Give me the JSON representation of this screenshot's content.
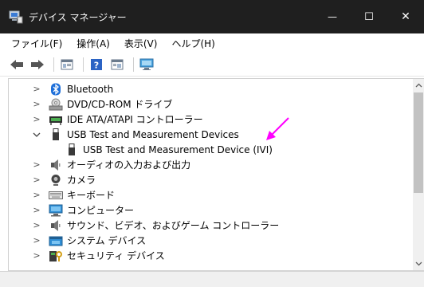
{
  "window": {
    "title": "デバイス マネージャー",
    "buttons": {
      "minimize": "—",
      "maximize": "☐",
      "close": "✕"
    }
  },
  "menu": [
    {
      "label": "ファイル(F)"
    },
    {
      "label": "操作(A)"
    },
    {
      "label": "表示(V)"
    },
    {
      "label": "ヘルプ(H)"
    }
  ],
  "toolbar": {
    "icons": [
      "back-icon",
      "forward-icon",
      "properties-icon",
      "help-icon",
      "details-icon",
      "monitor-icon"
    ]
  },
  "tree": {
    "items": [
      {
        "label": "Bluetooth",
        "expanded": false,
        "icon": "bluetooth-icon"
      },
      {
        "label": "DVD/CD-ROM ドライブ",
        "expanded": false,
        "icon": "dvd-drive-icon"
      },
      {
        "label": "IDE ATA/ATAPI コントローラー",
        "expanded": false,
        "icon": "ide-controller-icon"
      },
      {
        "label": "USB Test and Measurement Devices",
        "expanded": true,
        "icon": "usb-plug-icon"
      },
      {
        "label": "USB Test and Measurement Device (IVI)",
        "child": true,
        "icon": "usb-plug-icon"
      },
      {
        "label": "オーディオの入力および出力",
        "expanded": false,
        "icon": "speaker-icon"
      },
      {
        "label": "カメラ",
        "expanded": false,
        "icon": "camera-icon"
      },
      {
        "label": "キーボード",
        "expanded": false,
        "icon": "keyboard-icon"
      },
      {
        "label": "コンピューター",
        "expanded": false,
        "icon": "computer-icon"
      },
      {
        "label": "サウンド、ビデオ、およびゲーム コントローラー",
        "expanded": false,
        "icon": "speaker-icon"
      },
      {
        "label": "システム デバイス",
        "expanded": false,
        "icon": "system-device-icon"
      },
      {
        "label": "セキュリティ デバイス",
        "expanded": false,
        "icon": "security-device-icon"
      }
    ]
  },
  "colors": {
    "titlebar": "#1f1f1f",
    "annotation_arrow": "#ff00ff",
    "bluetooth": "#1e6fd9"
  }
}
